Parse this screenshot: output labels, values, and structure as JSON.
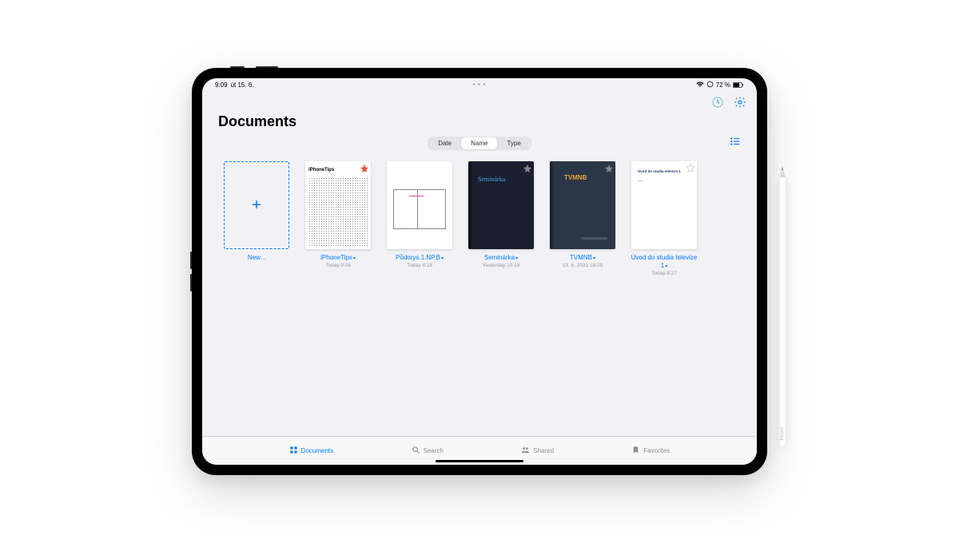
{
  "statusBar": {
    "time": "9:09",
    "date": "út 15. 6.",
    "battery": "72 %",
    "center_dots": "• • •"
  },
  "pageTitle": "Documents",
  "sort": {
    "options": [
      "Date",
      "Name",
      "Type"
    ],
    "active": "Name"
  },
  "newTile": {
    "label": "New..."
  },
  "documents": [
    {
      "name": "iPhoneTips",
      "date": "Today 9:08",
      "thumb": "iphonetips",
      "favorite": true
    },
    {
      "name": "Půdorys.1.NP.B",
      "date": "Today 8:18",
      "thumb": "floorplan",
      "favorite": false
    },
    {
      "name": "Seminárka",
      "date": "Yesterday 10:18",
      "thumb": "seminarka",
      "favorite": false,
      "favSlot": true
    },
    {
      "name": "TVMNB",
      "date": "13. 6. 2021 18:08",
      "thumb": "tvmnb",
      "favorite": false,
      "favSlot": true
    },
    {
      "name": "Úvod do studia televize 1",
      "date": "Today 8:27",
      "thumb": "uvod",
      "favorite": false,
      "favSlot": true
    }
  ],
  "thumbText": {
    "iphonetips_logo": "iPhoneTips",
    "seminarka_label": "Seminárka",
    "tvmnb_label": "TVMNB",
    "uvod_title": "Úvod do studia televize 1"
  },
  "tabs": {
    "documents": "Documents",
    "search": "Search",
    "shared": "Shared",
    "favorites": "Favorites"
  },
  "pencil": {
    "label": " Pencil"
  }
}
